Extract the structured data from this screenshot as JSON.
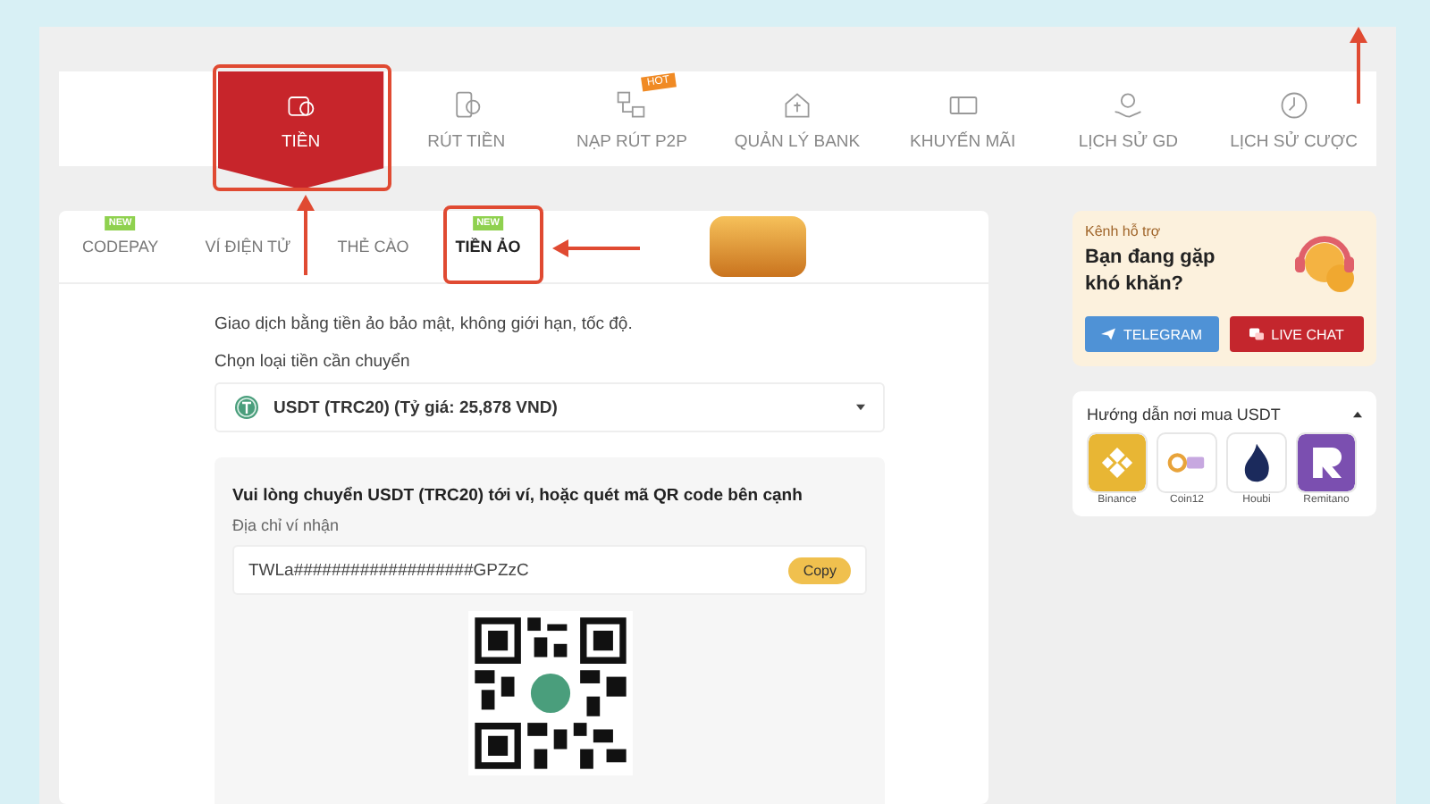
{
  "nav": {
    "items": [
      {
        "label": "TIỀN",
        "selected": true
      },
      {
        "label": "RÚT TIỀN",
        "selected": false
      },
      {
        "label": "NẠP RÚT P2P",
        "selected": false,
        "badge": "HOT"
      },
      {
        "label": "QUẢN LÝ BANK",
        "selected": false
      },
      {
        "label": "KHUYẾN MÃI",
        "selected": false
      },
      {
        "label": "LỊCH SỬ GD",
        "selected": false
      },
      {
        "label": "LỊCH SỬ CƯỢC",
        "selected": false
      }
    ]
  },
  "tabs": [
    {
      "label": "CODEPAY",
      "selected": false,
      "badge": "NEW"
    },
    {
      "label": "VÍ ĐIỆN TỬ",
      "selected": false
    },
    {
      "label": "THẺ CÀO",
      "selected": false
    },
    {
      "label": "TIỀN ẢO",
      "selected": true,
      "badge": "NEW"
    }
  ],
  "intro": "Giao dịch bằng tiền ảo bảo mật, không giới hạn, tốc độ.",
  "currency": {
    "label": "Chọn loại tiền cần chuyển",
    "value": "USDT (TRC20) (Tỷ giá: 25,878 VND)"
  },
  "transfer": {
    "instruction": "Vui lòng chuyển USDT (TRC20) tới ví, hoặc quét mã QR code bên cạnh",
    "address_label": "Địa chỉ ví nhận",
    "address": "TWLa###################GPZzC",
    "copy_button": "Copy"
  },
  "support": {
    "caption": "Kênh hỗ trợ",
    "heading": "Bạn đang gặp khó khăn?",
    "buttons": [
      {
        "label": "TELEGRAM",
        "kind": "telegram"
      },
      {
        "label": "LIVE CHAT",
        "kind": "livechat"
      }
    ]
  },
  "buy_guide": {
    "title": "Hướng dẫn nơi mua USDT",
    "expanded": true,
    "exchanges": [
      {
        "name": "Binance",
        "color": "#e8b634"
      },
      {
        "name": "Coin12",
        "color": "#ffffff"
      },
      {
        "name": "Houbi",
        "color": "#ffffff"
      },
      {
        "name": "Remitano",
        "color": "#7b4fb0"
      }
    ]
  }
}
